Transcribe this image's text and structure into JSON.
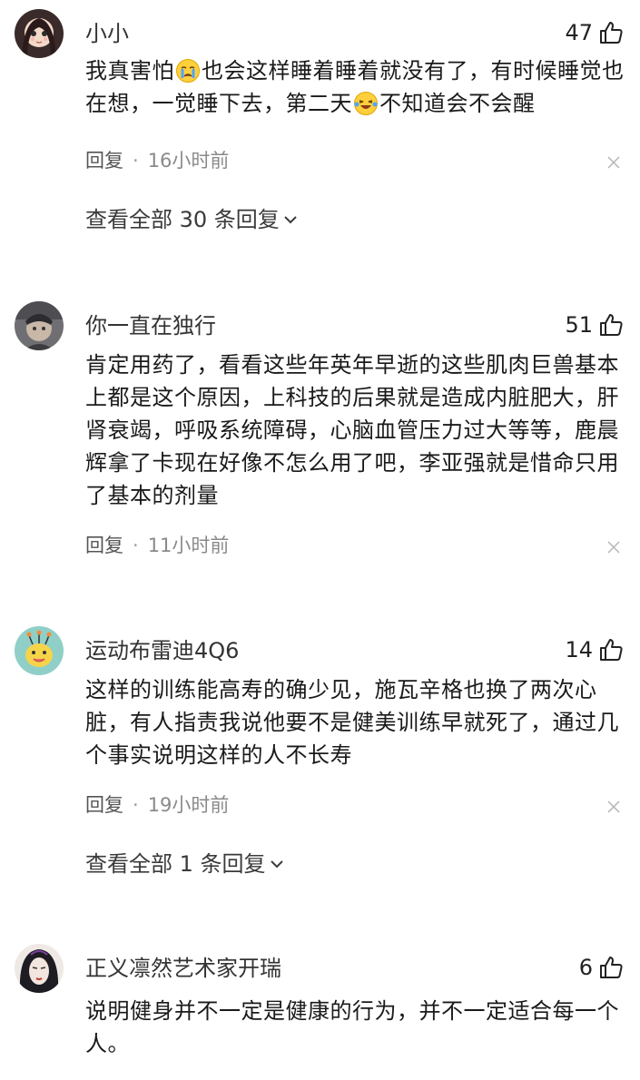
{
  "comments": [
    {
      "username": "小小",
      "likes": "47",
      "text_parts": [
        "我真害怕",
        "也会这样睡着睡着就没有了，有时候睡觉也在想，一觉睡下去，第二天",
        "不知道会不会醒"
      ],
      "emojis": [
        "crying-face-emoji",
        "laughing-tears-emoji"
      ],
      "reply_label": "回复",
      "dot": "·",
      "time": "16小时前",
      "view_replies": "查看全部 30 条回复"
    },
    {
      "username": "你一直在独行",
      "likes": "51",
      "text": "肯定用药了，看看这些年英年早逝的这些肌肉巨兽基本上都是这个原因，上科技的后果就是造成内脏肥大，肝肾衰竭，呼吸系统障碍，心脑血管压力过大等等，鹿晨辉拿了卡现在好像不怎么用了吧，李亚强就是惜命只用了基本的剂量",
      "reply_label": "回复",
      "dot": "·",
      "time": "11小时前"
    },
    {
      "username": "运动布雷迪4Q6",
      "likes": "14",
      "text": "这样的训练能高寿的确少见，施瓦辛格也换了两次心脏，有人指责我说他要不是健美训练早就死了，通过几个事实说明这样的人不长寿",
      "reply_label": "回复",
      "dot": "·",
      "time": "19小时前",
      "view_replies": "查看全部 1 条回复"
    },
    {
      "username": "正义凛然艺术家开瑞",
      "likes": "6",
      "text": "说明健身并不一定是健康的行为，并不一定适合每一个人。"
    }
  ],
  "icons": {
    "like": "thumbs-up-icon",
    "close": "close-icon",
    "expand": "chevron-down-icon"
  },
  "colors": {
    "text": "#1a1a1a",
    "meta": "#8a8a8a",
    "background": "#ffffff"
  }
}
